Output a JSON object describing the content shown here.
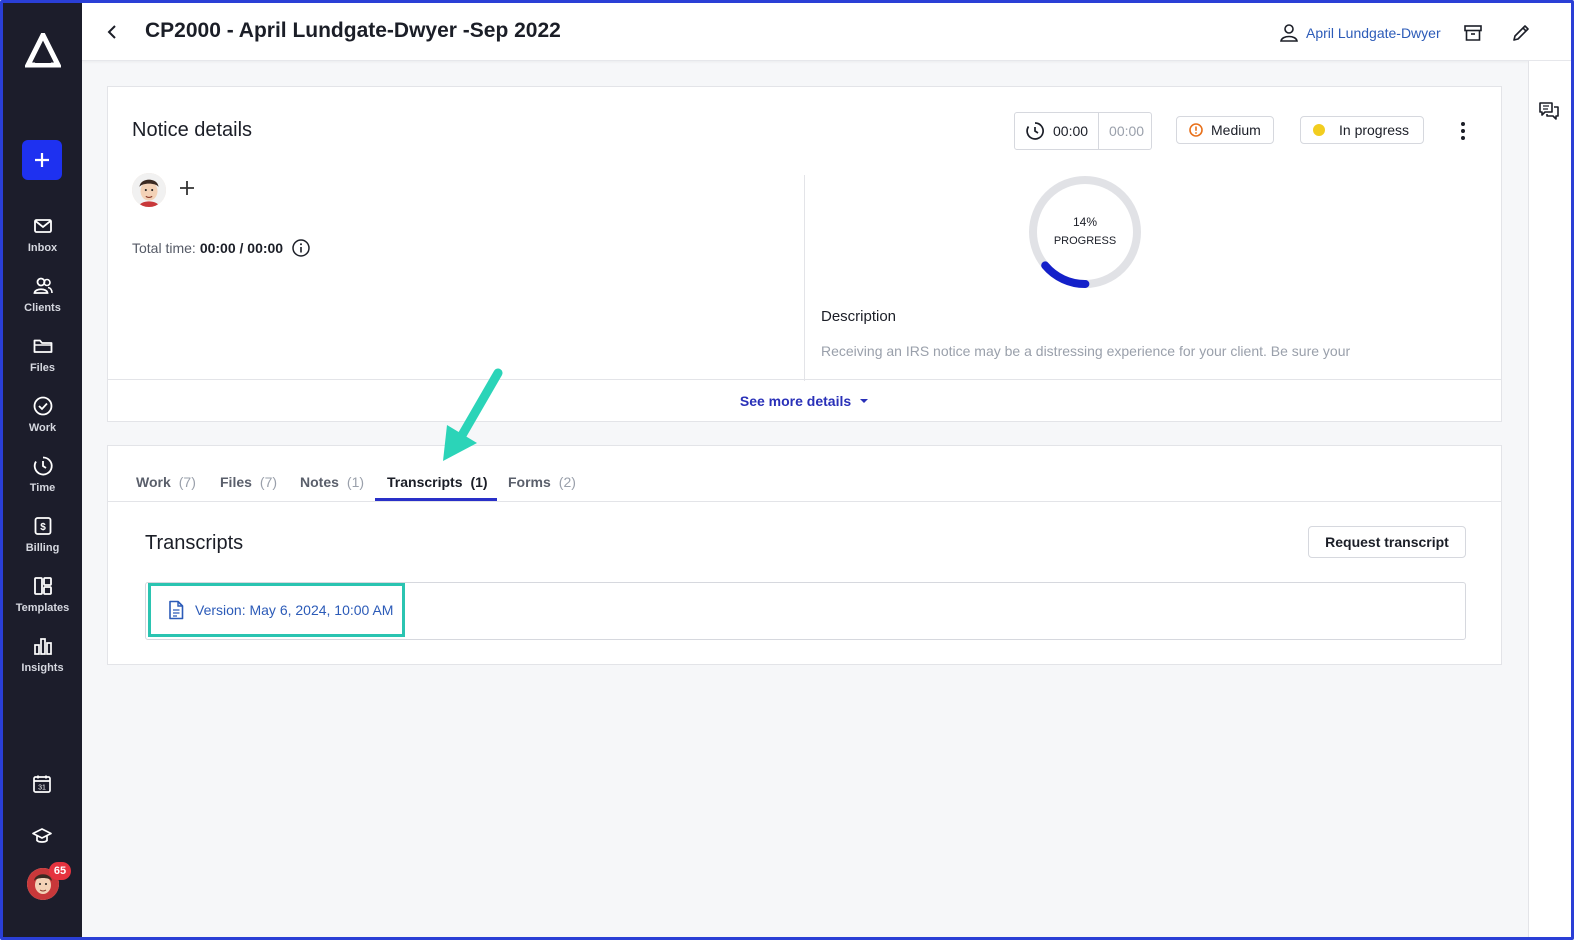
{
  "header": {
    "title": "CP2000 - April Lundgate-Dwyer -Sep 2022",
    "owner_name": "April Lundgate-Dwyer"
  },
  "sidebar": {
    "items": [
      {
        "label": "Inbox",
        "icon": "mail-icon"
      },
      {
        "label": "Clients",
        "icon": "clients-icon"
      },
      {
        "label": "Files",
        "icon": "folder-icon"
      },
      {
        "label": "Work",
        "icon": "check-circle-icon"
      },
      {
        "label": "Time",
        "icon": "clock-icon"
      },
      {
        "label": "Billing",
        "icon": "billing-icon"
      },
      {
        "label": "Templates",
        "icon": "templates-icon"
      },
      {
        "label": "Insights",
        "icon": "bar-chart-icon"
      }
    ],
    "notification_count": "65"
  },
  "notice": {
    "title": "Notice details",
    "timer_current": "00:00",
    "timer_estimate": "00:00",
    "priority": "Medium",
    "status": "In progress",
    "total_time_label": "Total time:",
    "total_time_value": "00:00 / 00:00",
    "progress_percent": "14%",
    "progress_label": "PROGRESS",
    "progress_fraction": 0.14,
    "description_label": "Description",
    "description_text": "Receiving an IRS notice may be a distressing experience for your client. Be sure your",
    "see_more": "See more details"
  },
  "tabs": [
    {
      "label": "Work",
      "count": "(7)"
    },
    {
      "label": "Files",
      "count": "(7)"
    },
    {
      "label": "Notes",
      "count": "(1)"
    },
    {
      "label": "Transcripts",
      "count": "(1)"
    },
    {
      "label": "Forms",
      "count": "(2)"
    }
  ],
  "transcripts": {
    "title": "Transcripts",
    "request_button": "Request transcript",
    "items": [
      {
        "label": "Version: May 6, 2024, 10:00 AM"
      }
    ]
  },
  "colors": {
    "sidebar_bg": "#1c1d2b",
    "accent": "#1e31f0",
    "highlight": "#2bc4b1",
    "link": "#2c5bb8"
  }
}
